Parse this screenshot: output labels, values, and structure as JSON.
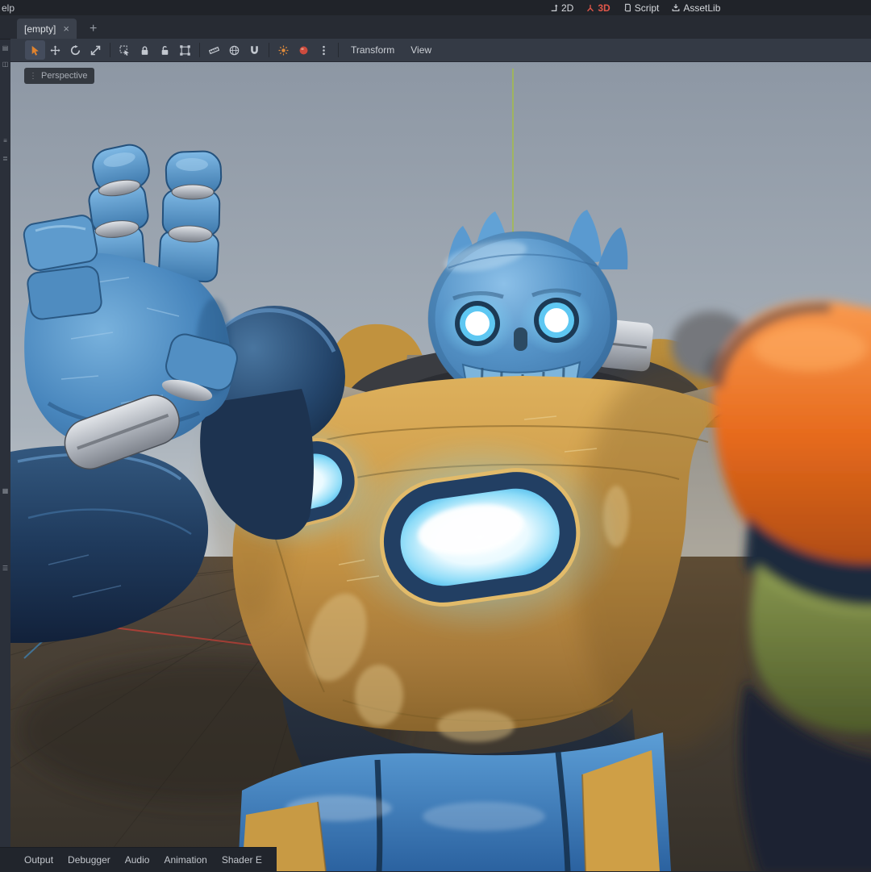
{
  "menubar": {
    "left_fragment": "elp",
    "items": [
      {
        "label": "2D",
        "icon": "2d-icon"
      },
      {
        "label": "3D",
        "icon": "3d-axes-icon",
        "active": true
      },
      {
        "label": "Script",
        "icon": "script-icon"
      },
      {
        "label": "AssetLib",
        "icon": "assetlib-icon"
      }
    ]
  },
  "scene_tabs": {
    "active_label": "[empty]",
    "close_glyph": "×",
    "add_glyph": "+"
  },
  "toolbar": {
    "transform_label": "Transform",
    "view_label": "View",
    "tools": [
      "select",
      "move",
      "rotate",
      "scale",
      "list-select",
      "lock",
      "unlock",
      "group",
      "ruler",
      "use-local-space",
      "snap",
      "preview-sunlight",
      "preview-environment",
      "extra-options"
    ]
  },
  "viewport": {
    "perspective_label": "Perspective",
    "handle_glyph": "⋮"
  },
  "dock_strip": {
    "glyphs": [
      "▤",
      "◫",
      "≡",
      "≣",
      "▦",
      "☰"
    ]
  },
  "bottom_bar": {
    "items": [
      "Output",
      "Debugger",
      "Audio",
      "Animation",
      "Shader E"
    ]
  },
  "colors": {
    "accent_red": "#e0574a",
    "tool_active_orange": "#e0832e",
    "glow_cyan": "#55c8f5",
    "armor_yellow": "#c89544",
    "robot_blue": "#4886bd",
    "pad_orange": "#e2641a",
    "editor_bg": "#21252c"
  }
}
